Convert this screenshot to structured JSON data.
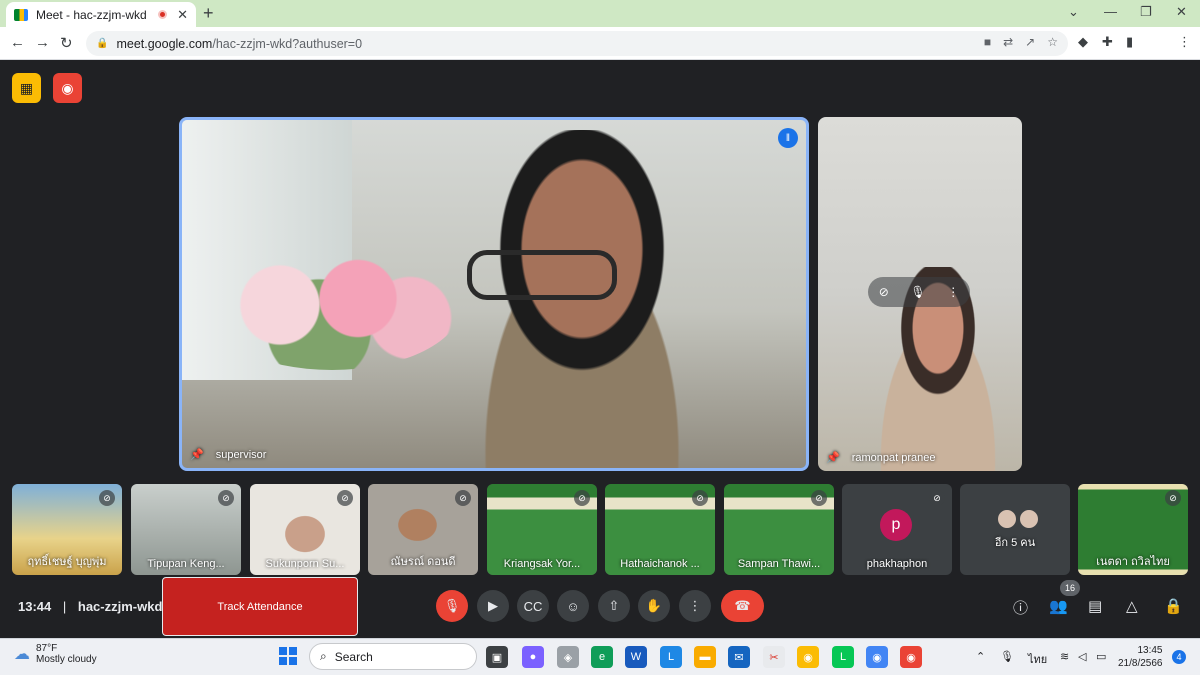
{
  "browser": {
    "tab_title": "Meet - hac-zzjm-wkd",
    "new_tab": "+",
    "minimize": "⌄",
    "url_host": "meet.google.com",
    "url_path": "/hac-zzjm-wkd?authuser=0"
  },
  "meet": {
    "main_speaker": "supervisor",
    "side_speaker": "ramonpat pranee",
    "participants": [
      {
        "name": "ฤทธิ์เชษฐ์ บุญพุ่ม"
      },
      {
        "name": "Tipupan Keng..."
      },
      {
        "name": "Sukunporn Su..."
      },
      {
        "name": "ณัษรณ์ ดอนดี"
      },
      {
        "name": "Kriangsak Yor..."
      },
      {
        "name": "Hathaichanok ..."
      },
      {
        "name": "Sampan Thawi..."
      },
      {
        "name": "phakhaphon",
        "initial": "p"
      },
      {
        "name": "อีก 5 คน"
      },
      {
        "name": "เนตดา ถวิลไทย"
      }
    ],
    "clock": "13:44",
    "separator": "|",
    "meeting_code": "hac-zzjm-wkd",
    "track_attendance": "Track Attendance",
    "people_count": "16"
  },
  "taskbar": {
    "temp": "87°F",
    "weather": "Mostly cloudy",
    "search": "Search",
    "lang": "ไทย",
    "time": "13:45",
    "date": "21/8/2566",
    "notifications": "4"
  },
  "colors": {
    "accent": "#8ab4f8",
    "danger": "#ea4335",
    "bg": "#202124"
  }
}
